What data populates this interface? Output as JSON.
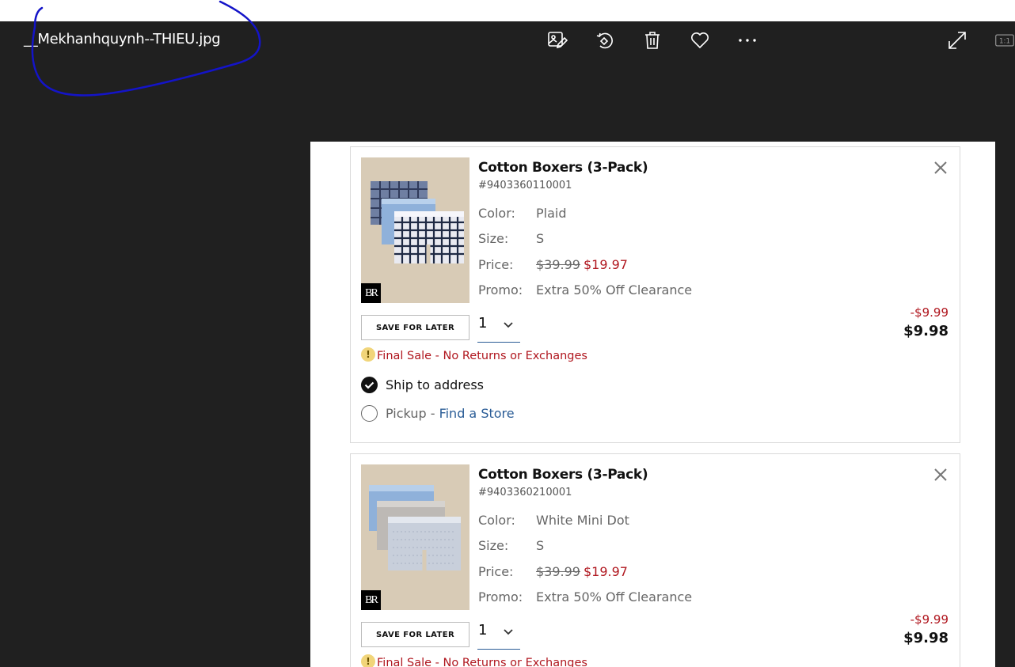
{
  "viewer": {
    "filename": "__Mekhanhquynh--THIEU.jpg",
    "toolbar": [
      "edit-image-icon",
      "rotate-icon",
      "delete-icon",
      "favorite-icon",
      "more-icon"
    ],
    "right_tools": [
      "fullscreen-icon",
      "actual-size-icon"
    ],
    "actual_size_label": "1:1"
  },
  "cart": {
    "items": [
      {
        "title": "Cotton Boxers (3-Pack)",
        "sku": "#9403360110001",
        "color_label": "Color:",
        "color": "Plaid",
        "size_label": "Size:",
        "size": "S",
        "price_label": "Price:",
        "price_original": "$39.99",
        "price_sale": "$19.97",
        "promo_label": "Promo:",
        "promo": "Extra 50% Off Clearance",
        "save_label": "SAVE FOR LATER",
        "quantity": "1",
        "discount": "-$9.99",
        "total": "$9.98",
        "final_sale": "Final Sale - No Returns or Exchanges",
        "ship_label": "Ship to address",
        "pickup_label": "Pickup - ",
        "find_store": "Find a Store",
        "logo": "BR"
      },
      {
        "title": "Cotton Boxers (3-Pack)",
        "sku": "#9403360210001",
        "color_label": "Color:",
        "color": "White Mini Dot",
        "size_label": "Size:",
        "size": "S",
        "price_label": "Price:",
        "price_original": "$39.99",
        "price_sale": "$19.97",
        "promo_label": "Promo:",
        "promo": "Extra 50% Off Clearance",
        "save_label": "SAVE FOR LATER",
        "quantity": "1",
        "discount": "-$9.99",
        "total": "$9.98",
        "final_sale": "Final Sale - No Returns or Exchanges",
        "logo": "BR"
      }
    ]
  },
  "colors": {
    "sale": "#b0171f",
    "link": "#2a5c96",
    "viewer_bg": "#202020",
    "annotation": "#1414c8"
  }
}
